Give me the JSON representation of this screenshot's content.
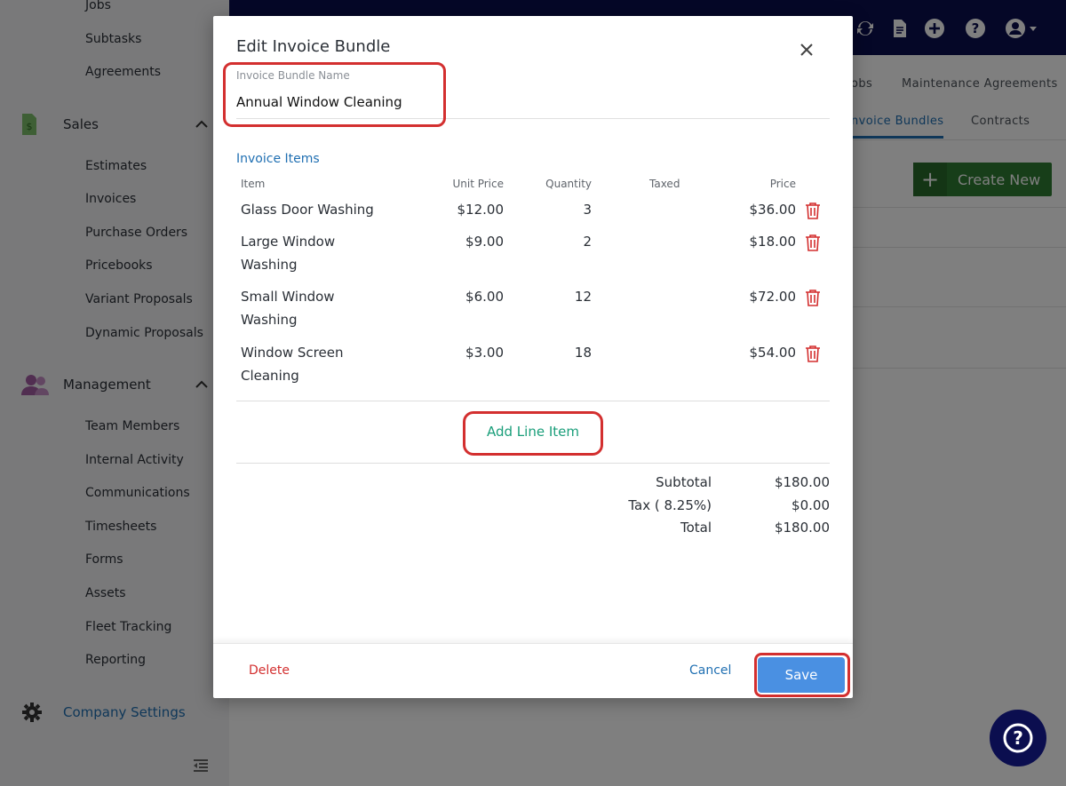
{
  "sidebar": {
    "top_items": [
      "Jobs",
      "Subtasks",
      "Agreements"
    ],
    "sales": {
      "label": "Sales",
      "items": [
        "Estimates",
        "Invoices",
        "Purchase Orders",
        "Pricebooks",
        "Variant Proposals",
        "Dynamic Proposals"
      ]
    },
    "management": {
      "label": "Management",
      "items": [
        "Team Members",
        "Internal Activity",
        "Communications",
        "Timesheets",
        "Forms",
        "Assets",
        "Fleet Tracking",
        "Reporting"
      ]
    },
    "company_settings": "Company Settings"
  },
  "subnav": {
    "jobs_partial": "obs",
    "maintenance": "Maintenance Agreements",
    "invoice_bundles_partial": "nvoice Bundles",
    "contracts": "Contracts"
  },
  "create_new_label": "Create New",
  "modal": {
    "title": "Edit Invoice Bundle",
    "name_label": "Invoice Bundle Name",
    "name_value": "Annual Window Cleaning",
    "section_title": "Invoice Items",
    "columns": {
      "item": "Item",
      "unit_price": "Unit Price",
      "quantity": "Quantity",
      "taxed": "Taxed",
      "price": "Price"
    },
    "rows": [
      {
        "item_line1": "Glass Door Washing",
        "item_line2": "",
        "unit_price": "$12.00",
        "quantity": "3",
        "price": "$36.00"
      },
      {
        "item_line1": "Large Window",
        "item_line2": "Washing",
        "unit_price": "$9.00",
        "quantity": "2",
        "price": "$18.00"
      },
      {
        "item_line1": "Small Window",
        "item_line2": "Washing",
        "unit_price": "$6.00",
        "quantity": "12",
        "price": "$72.00"
      },
      {
        "item_line1": "Window Screen",
        "item_line2": "Cleaning",
        "unit_price": "$3.00",
        "quantity": "18",
        "price": "$54.00"
      }
    ],
    "add_line_item": "Add Line Item",
    "summary": {
      "subtotal_label": "Subtotal",
      "subtotal_value": "$180.00",
      "tax_label": "Tax ( 8.25%)",
      "tax_value": "$0.00",
      "total_label": "Total",
      "total_value": "$180.00"
    },
    "footer": {
      "delete": "Delete",
      "cancel": "Cancel",
      "save": "Save"
    }
  },
  "colors": {
    "navy": "#0b0e4f",
    "link_blue": "#1f6fb2",
    "danger": "#d32f2f",
    "save": "#4a90e2",
    "create_green": "#2f7d32",
    "teal": "#1a9e7a"
  }
}
